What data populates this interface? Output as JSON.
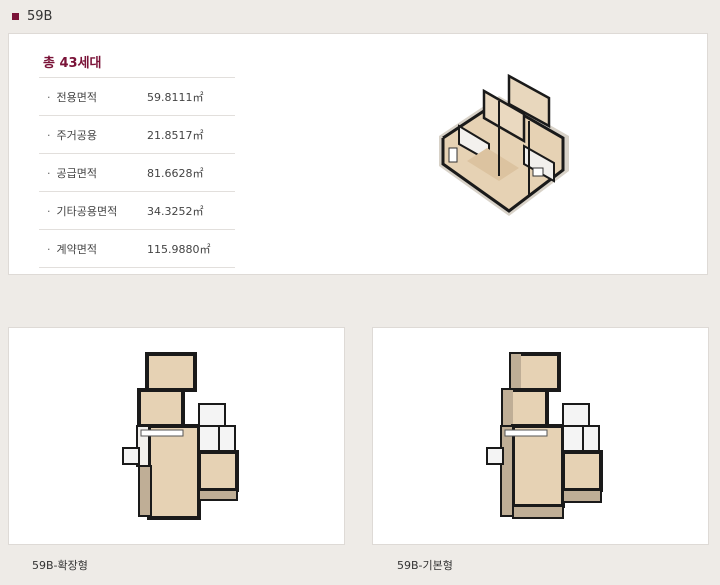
{
  "header": {
    "title": "59B"
  },
  "spec": {
    "total_label": "총 43세대",
    "rows": [
      {
        "label": "전용면적",
        "value": "59.8111㎡"
      },
      {
        "label": "주거공용",
        "value": "21.8517㎡"
      },
      {
        "label": "공급면적",
        "value": "81.6628㎡"
      },
      {
        "label": "기타공용면적",
        "value": "34.3252㎡"
      },
      {
        "label": "계약면적",
        "value": "115.9880㎡"
      }
    ]
  },
  "plans": [
    {
      "caption": "59B-확장형"
    },
    {
      "caption": "59B-기본형"
    }
  ],
  "colors": {
    "accent": "#7a1338",
    "wood": "#e6d2b4",
    "wall": "#1a1a1a"
  }
}
